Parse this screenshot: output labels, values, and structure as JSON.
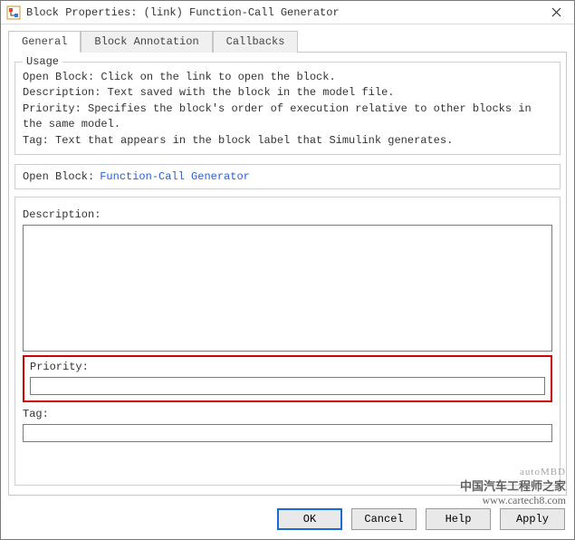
{
  "window": {
    "title": "Block Properties: (link) Function-Call Generator",
    "close_icon": "close"
  },
  "tabs": {
    "general": "General",
    "block_annotation": "Block Annotation",
    "callbacks": "Callbacks"
  },
  "usage": {
    "legend": "Usage",
    "text": "Open Block: Click on the link to open the block.\nDescription: Text saved with the block in the model file.\nPriority: Specifies the block's order of execution relative to other blocks in the same model.\nTag: Text that appears in the block label that Simulink generates."
  },
  "open_block": {
    "label": "Open Block:",
    "link_text": "Function-Call Generator"
  },
  "fields": {
    "description_label": "Description:",
    "description_value": "",
    "priority_label": "Priority:",
    "priority_value": "",
    "tag_label": "Tag:",
    "tag_value": ""
  },
  "buttons": {
    "ok": "OK",
    "cancel": "Cancel",
    "help": "Help",
    "apply": "Apply"
  },
  "watermark": {
    "line1": "中国汽车工程师之家",
    "line2": "www.cartech8.com",
    "brand": "autoMBD"
  }
}
